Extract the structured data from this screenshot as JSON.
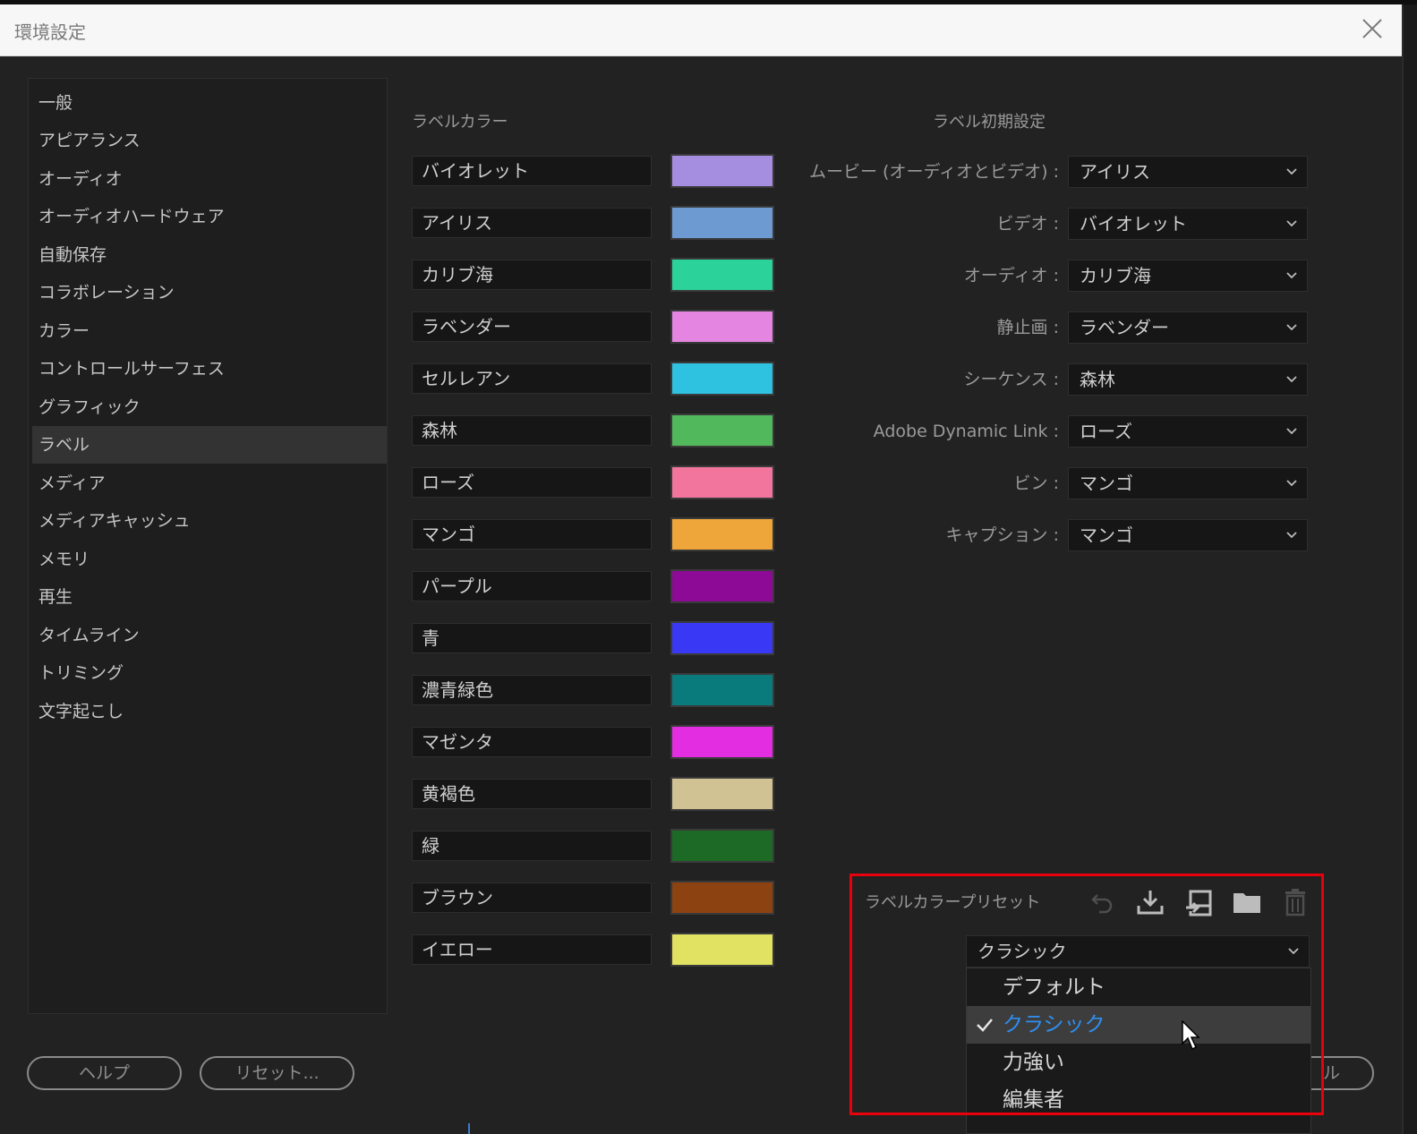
{
  "window": {
    "title": "環境設定"
  },
  "sidebar": {
    "items": [
      {
        "label": "一般"
      },
      {
        "label": "アピアランス"
      },
      {
        "label": "オーディオ"
      },
      {
        "label": "オーディオハードウェア"
      },
      {
        "label": "自動保存"
      },
      {
        "label": "コラボレーション"
      },
      {
        "label": "カラー"
      },
      {
        "label": "コントロールサーフェス"
      },
      {
        "label": "グラフィック"
      },
      {
        "label": "ラベル"
      },
      {
        "label": "メディア"
      },
      {
        "label": "メディアキャッシュ"
      },
      {
        "label": "メモリ"
      },
      {
        "label": "再生"
      },
      {
        "label": "タイムライン"
      },
      {
        "label": "トリミング"
      },
      {
        "label": "文字起こし"
      }
    ],
    "active_item": "ラベル"
  },
  "label_colors": {
    "title": "ラベルカラー",
    "items": [
      {
        "name": "バイオレット",
        "color": "#a58de0"
      },
      {
        "name": "アイリス",
        "color": "#6e9ad2"
      },
      {
        "name": "カリブ海",
        "color": "#2bd39a"
      },
      {
        "name": "ラベンダー",
        "color": "#e385e1"
      },
      {
        "name": "セルレアン",
        "color": "#2ec2e0"
      },
      {
        "name": "森林",
        "color": "#51b85b"
      },
      {
        "name": "ローズ",
        "color": "#f2759e"
      },
      {
        "name": "マンゴ",
        "color": "#eea63b"
      },
      {
        "name": "パープル",
        "color": "#8d0a96"
      },
      {
        "name": "青",
        "color": "#3939f5"
      },
      {
        "name": "濃青緑色",
        "color": "#0a7b7c"
      },
      {
        "name": "マゼンタ",
        "color": "#e32de1"
      },
      {
        "name": "黄褐色",
        "color": "#d1c294"
      },
      {
        "name": "緑",
        "color": "#1c6a25"
      },
      {
        "name": "ブラウン",
        "color": "#8d4211"
      },
      {
        "name": "イエロー",
        "color": "#e2e262"
      }
    ]
  },
  "label_defaults": {
    "title": "ラベル初期設定",
    "rows": [
      {
        "label": "ムービー (オーディオとビデオ) :",
        "value": "アイリス"
      },
      {
        "label": "ビデオ :",
        "value": "バイオレット"
      },
      {
        "label": "オーディオ :",
        "value": "カリブ海"
      },
      {
        "label": "静止画 :",
        "value": "ラベンダー"
      },
      {
        "label": "シーケンス :",
        "value": "森林"
      },
      {
        "label": "Adobe Dynamic Link :",
        "value": "ローズ"
      },
      {
        "label": "ビン :",
        "value": "マンゴ"
      },
      {
        "label": "キャプション :",
        "value": "マンゴ"
      }
    ]
  },
  "preset": {
    "title": "ラベルカラープリセット",
    "tools": [
      "undo-icon",
      "import-icon",
      "export-icon",
      "folder-icon",
      "trash-icon"
    ],
    "selected": "クラシック",
    "options": [
      {
        "label": "デフォルト"
      },
      {
        "label": "クラシック"
      },
      {
        "label": "力強い"
      },
      {
        "label": "編集者"
      }
    ],
    "highlight_color": "#e8000d",
    "selected_text_color": "#2e8ff0"
  },
  "buttons": {
    "help": "ヘルプ",
    "reset": "リセット...",
    "cancel_partial": "ル"
  }
}
